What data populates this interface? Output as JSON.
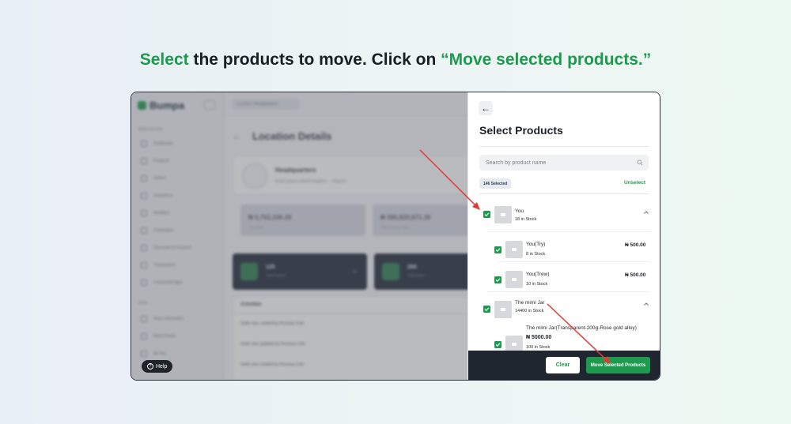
{
  "headline": {
    "highlight": "Select",
    "middle": " the products to move. Click on ",
    "quoted": "“Move selected products.”"
  },
  "background_app": {
    "logo": "Bumpa",
    "location_pill": "Location: Headquarters",
    "sections": {
      "quick_access": "Quick Access",
      "store": "Store"
    },
    "nav_items": [
      "Dashboard",
      "Products",
      "Orders",
      "Customers",
      "Analytics",
      "Campaigns",
      "Discounts & Coupons",
      "Transactions",
      "Connected Apps"
    ],
    "store_items": [
      "Store Information",
      "Bank Details",
      "Ad Hoc"
    ],
    "help_label": "Help",
    "page_title": "Location Details",
    "location_name": "Headquarters",
    "location_address": "Road palace United Kingdom ... Reports",
    "stats": [
      {
        "value": "₦ 5,762,336.25",
        "label": "Total Sales"
      },
      {
        "value": "₦ 380,820,871.30",
        "label": "Total Inventory Value"
      }
    ],
    "dark_cards": [
      {
        "value": "125",
        "label": "Total Products"
      },
      {
        "value": "266",
        "label": "Total Orders"
      }
    ],
    "activities_title": "Activities",
    "activities": [
      "Order was created by Precious Cole",
      "Order was updated by Precious Cole",
      "Order was created by Precious Cole",
      "Order was created by Precious Cole"
    ]
  },
  "panel": {
    "title": "Select Products",
    "search_placeholder": "Search by product name",
    "selected_badge": "146 Selected",
    "unselect_label": "Unselect",
    "products": [
      {
        "name": "You",
        "stock": "18 in Stock",
        "checked": true,
        "expanded": true,
        "variants": [
          {
            "name": "You(Try)",
            "stock": "8 in Stock",
            "price": "₦ 500.00",
            "checked": true
          },
          {
            "name": "You(Trew)",
            "stock": "10 in Stock",
            "price": "₦ 500.00",
            "checked": true
          }
        ]
      },
      {
        "name": "The mimi Jar",
        "stock": "14400 in Stock",
        "checked": true,
        "expanded": true,
        "variants": [
          {
            "name": "The mimi Jar(Transparent-200g-Rose gold alloy)",
            "price": "₦ 5000.00",
            "stock": "100 in Stock",
            "checked": true
          }
        ]
      }
    ],
    "clear_label": "Clear",
    "move_label": "Move Selected Products"
  },
  "colors": {
    "accent_green": "#1d9a4d",
    "footer_dark": "#1f262f",
    "annotation_red": "#e53935"
  }
}
